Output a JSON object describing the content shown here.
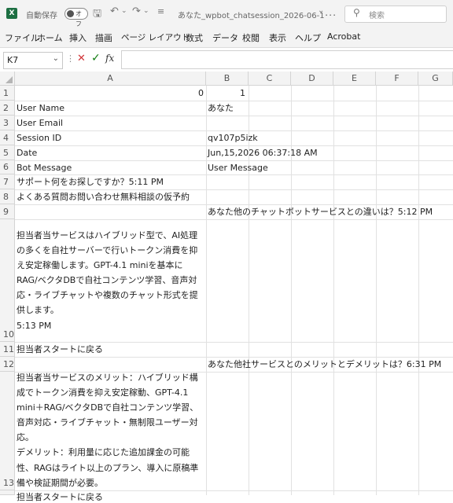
{
  "titlebar": {
    "logo": "X",
    "autosave_label": "自動保存",
    "autosave_state": "オフ",
    "doc_title": "あなた_wpbot_chatsession_2026-06-1･･･",
    "search_placeholder": "検索",
    "icons": [
      "excel-logo-icon",
      "save-icon",
      "undo-icon",
      "redo-icon",
      "customize-icon",
      "chevron-down-icon",
      "search-icon"
    ]
  },
  "menu": [
    "ファイル",
    "ホーム",
    "挿入",
    "描画",
    "ページ レイアウト",
    "数式",
    "データ",
    "校閲",
    "表示",
    "ヘルプ",
    "Acrobat"
  ],
  "formula_bar": {
    "name_box": "K7",
    "cancel_symbol": "✕",
    "enter_symbol": "✓",
    "fx_label": "fx",
    "content": ""
  },
  "columns": [
    "A",
    "B",
    "C",
    "D",
    "E",
    "F",
    "G"
  ],
  "rows": [
    "1",
    "2",
    "3",
    "4",
    "5",
    "6",
    "7",
    "8",
    "9",
    "10",
    "11",
    "12",
    "13"
  ],
  "cells": {
    "A1": "0",
    "B1": "1",
    "A2": "User Name",
    "B2": "あなた",
    "A3": "User Email",
    "A4": "Session ID",
    "B4": "qv107p5izk",
    "A5": "Date",
    "B5": "Jun,15,2026 06:37:18 AM",
    "A6": "Bot Message",
    "B6": "User Message",
    "A7": "サポート何をお探しですか？5:11 PM",
    "A8": "よくある質問お問い合わせ無料相談の仮予約",
    "B9": "あなた他のチャットボットサービスとの違いは？5:12 PM",
    "A10": [
      "",
      "担当者当サービスはハイブリッド型で、AI処理",
      "の多くを自社サーバーで行いトークン消費を抑",
      "え安定稼働します。GPT-4.1 miniを基本に",
      "RAG/ベクタDBで自社コンテンツ学習、音声対",
      "応・ライブチャットや複数のチャット形式を提",
      "供します。",
      "5:13 PM"
    ],
    "A11": "担当者スタートに戻る",
    "B12": "あなた他社サービスとのメリットとデメリットは？6:31 PM",
    "A13": [
      "担当者当サービスのメリット：ハイブリッド構",
      "成でトークン消費を抑え安定稼動、GPT-4.1",
      "mini＋RAG/ベクタDBで自社コンテンツ学習、",
      "音声対応・ライブチャット・無制限ユーザー対",
      "応。",
      "デメリット：利用量に応じた追加課金の可能",
      "性、RAGはライト以上のプラン、導入に原稿準",
      "備や検証期間が必要。"
    ],
    "A14": "担当者スタートに戻る"
  },
  "colors": {
    "excel_green": "#1d6f42",
    "cancel_red": "#d13438",
    "enter_green": "#107c10"
  }
}
